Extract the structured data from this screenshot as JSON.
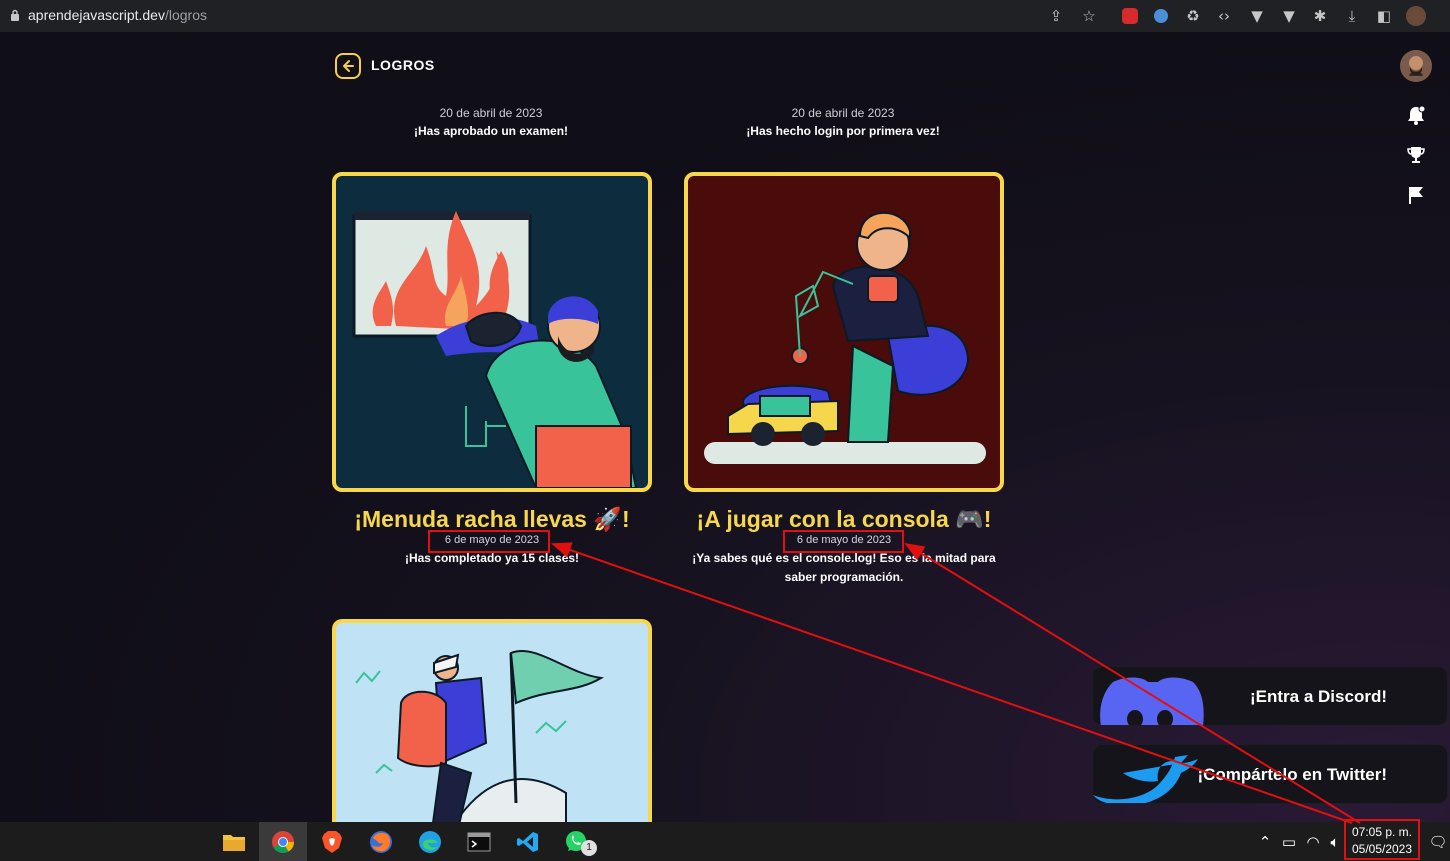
{
  "browser": {
    "url_domain": "aprendejavascript.dev",
    "url_path": "/logros"
  },
  "header": {
    "title": "LOGROS"
  },
  "top_achievements": [
    {
      "date": "20 de abril de 2023",
      "description": "¡Has aprobado un examen!"
    },
    {
      "date": "20 de abril de 2023",
      "description": "¡Has hecho login por primera vez!"
    }
  ],
  "cards": [
    {
      "title": "¡Menuda racha llevas 🚀!",
      "date": "6 de mayo de 2023",
      "description": "¡Has completado ya 15 clases!",
      "bg": "#0d2d3f"
    },
    {
      "title": "¡A jugar con la consola 🎮!",
      "date": "6 de mayo de 2023",
      "description": "¡Ya sabes qué es el console.log! Eso es la mitad para saber programación.",
      "bg": "#4a0b0b"
    },
    {
      "bg": "#bfe3f5"
    }
  ],
  "ctas": {
    "discord": "¡Entra a Discord!",
    "twitter": "¡Compártelo en Twitter!"
  },
  "taskbar": {
    "time": "07:05 p. m.",
    "date": "05/05/2023",
    "whatsapp_badge": "1"
  },
  "colors": {
    "accent": "#f7d74b",
    "annotation": "#e01010"
  }
}
